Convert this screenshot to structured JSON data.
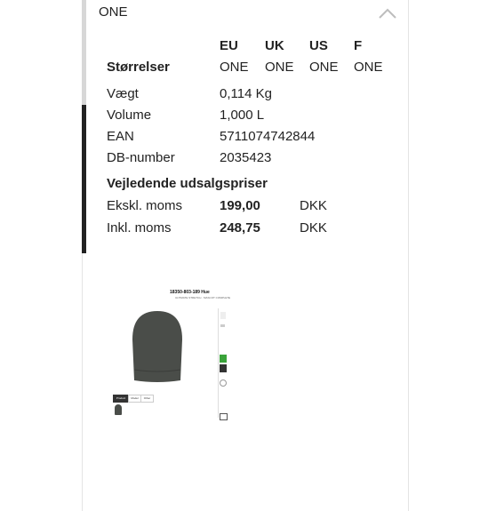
{
  "size_selector": {
    "value": "ONE"
  },
  "sizes": {
    "row_label": "Størrelser",
    "columns": [
      {
        "system": "EU",
        "value": "ONE"
      },
      {
        "system": "UK",
        "value": "ONE"
      },
      {
        "system": "US",
        "value": "ONE"
      },
      {
        "system": "F",
        "value": "ONE"
      }
    ]
  },
  "specs": [
    {
      "label": "Vægt",
      "value": "0,114 Kg"
    },
    {
      "label": "Volume",
      "value": "1,000 L"
    },
    {
      "label": "EAN",
      "value": "5711074742844"
    },
    {
      "label": "DB-number",
      "value": "2035423"
    }
  ],
  "prices": {
    "heading": "Vejledende udsalgspriser",
    "rows": [
      {
        "label": "Ekskl. moms",
        "amount": "199,00",
        "currency": "DKK"
      },
      {
        "label": "Inkl. moms",
        "amount": "248,75",
        "currency": "DKK"
      }
    ]
  },
  "product_thumbnail": {
    "title": "18350-803-189 Hue",
    "subtitle": "ULTIMATE STRETCH · MASCOT COMPLETE",
    "tabs": [
      "Product",
      "Model",
      "Other"
    ],
    "beanie_color": "#4a4d49",
    "swatch_colors": [
      "#3aa33a",
      "#333333"
    ]
  },
  "colors": {
    "accent_dark": "#222222",
    "accent_light": "#d7d7d7"
  }
}
